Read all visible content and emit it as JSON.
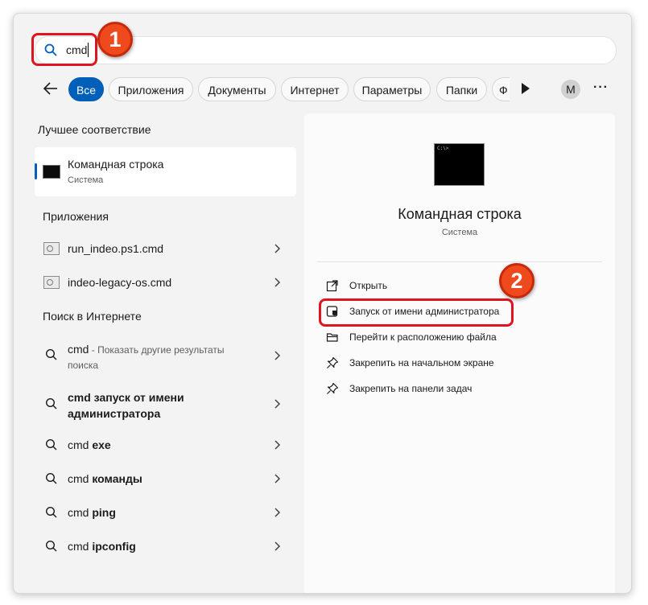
{
  "search": {
    "query": "cmd"
  },
  "callouts": {
    "one": "1",
    "two": "2"
  },
  "filters": {
    "chips": [
      "Все",
      "Приложения",
      "Документы",
      "Интернет",
      "Параметры",
      "Папки",
      "Ф"
    ],
    "avatar": "M",
    "more": "···"
  },
  "left": {
    "best_match_header": "Лучшее соответствие",
    "best_match": {
      "title": "Командная строка",
      "subtitle": "Система"
    },
    "apps_header": "Приложения",
    "apps": [
      "run_indeo.ps1.cmd",
      "indeo-legacy-os.cmd"
    ],
    "web_header": "Поиск в Интернете",
    "web": {
      "first_bold": "cmd",
      "first_suffix": " - Показать другие результаты",
      "first_line2": "поиска",
      "second_line1": "cmd запуск от имени",
      "second_line2": "администратора",
      "rows": [
        {
          "q": "cmd",
          "bold": "exe"
        },
        {
          "q": "cmd",
          "bold": "команды"
        },
        {
          "q": "cmd",
          "bold": "ping"
        },
        {
          "q": "cmd",
          "bold": "ipconfig"
        }
      ]
    }
  },
  "right": {
    "title": "Командная строка",
    "subtitle": "Система",
    "actions": [
      {
        "label": "Открыть",
        "icon": "open-external-icon"
      },
      {
        "label": "Запуск от имени администратора",
        "icon": "shield-admin-icon"
      },
      {
        "label": "Перейти к расположению файла",
        "icon": "folder-open-icon"
      },
      {
        "label": "Закрепить на начальном экране",
        "icon": "pin-icon"
      },
      {
        "label": "Закрепить на панели задач",
        "icon": "pin-icon"
      }
    ]
  },
  "colors": {
    "accent": "#005fb8",
    "highlight": "#e0141e",
    "badge": "#ef4a1e"
  }
}
